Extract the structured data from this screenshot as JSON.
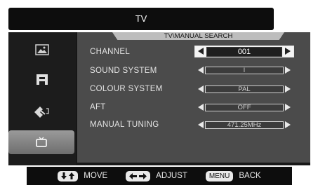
{
  "window": {
    "title": "TV"
  },
  "menu": {
    "header": "TV\\MANUAL SEARCH",
    "items": [
      {
        "label": "CHANNEL",
        "value": "001"
      },
      {
        "label": "SOUND SYSTEM",
        "value": "I"
      },
      {
        "label": "COLOUR SYSTEM",
        "value": "PAL"
      },
      {
        "label": "AFT",
        "value": "OFF"
      },
      {
        "label": "MANUAL TUNING",
        "value": "471.25MHz"
      }
    ]
  },
  "sidebar": {
    "icons": [
      "picture-icon",
      "audio-icon",
      "settings-icon",
      "tv-icon"
    ]
  },
  "footer": {
    "move_label": "MOVE",
    "adjust_label": "ADJUST",
    "menu_key_label": "MENU",
    "back_label": "BACK"
  },
  "colors": {
    "panel": "#171717",
    "content": "#4b4b4b",
    "highlight": "#f4f4f4"
  }
}
